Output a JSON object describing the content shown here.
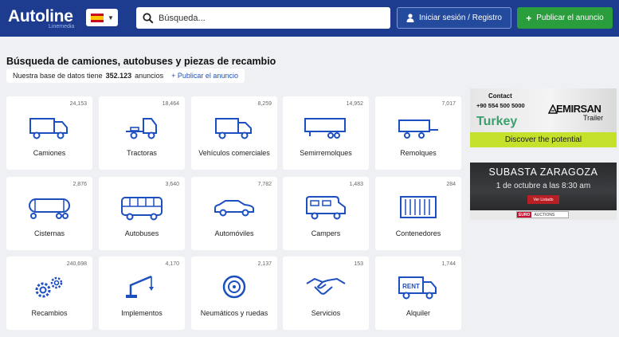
{
  "header": {
    "logo": "Autoline",
    "logo_sub": "Linemedia",
    "search_placeholder": "Búsqueda...",
    "login_label": "Iniciar sesión / Registro",
    "publish_label": "Publicar el anuncio"
  },
  "main": {
    "title": "Búsqueda de camiones, autobuses y piezas de recambio",
    "db_text": "Nuestra base de datos tiene",
    "db_count": "352.123",
    "db_suffix": "anuncios",
    "db_link": "+ Publicar el anuncio"
  },
  "categories": [
    {
      "label": "Camiones",
      "count": "24,153",
      "icon": "truck-icon"
    },
    {
      "label": "Tractoras",
      "count": "18,464",
      "icon": "tractor-unit-icon"
    },
    {
      "label": "Vehículos comerciales",
      "count": "8,259",
      "icon": "van-icon"
    },
    {
      "label": "Semirremolques",
      "count": "14,952",
      "icon": "semitrailer-icon"
    },
    {
      "label": "Remolques",
      "count": "7,017",
      "icon": "trailer-icon"
    },
    {
      "label": "Cisternas",
      "count": "2,876",
      "icon": "tank-icon"
    },
    {
      "label": "Autobuses",
      "count": "3,640",
      "icon": "bus-icon"
    },
    {
      "label": "Automóviles",
      "count": "7,782",
      "icon": "car-icon"
    },
    {
      "label": "Campers",
      "count": "1,483",
      "icon": "camper-icon"
    },
    {
      "label": "Contenedores",
      "count": "284",
      "icon": "container-icon"
    },
    {
      "label": "Recambios",
      "count": "240,698",
      "icon": "gears-icon"
    },
    {
      "label": "Implementos",
      "count": "4,170",
      "icon": "crane-icon"
    },
    {
      "label": "Neumáticos y ruedas",
      "count": "2,137",
      "icon": "wheel-icon"
    },
    {
      "label": "Servicios",
      "count": "153",
      "icon": "handshake-icon"
    },
    {
      "label": "Alquiler",
      "count": "1,744",
      "icon": "rent-truck-icon"
    }
  ],
  "ads": {
    "ad1": {
      "contact": "Contact",
      "phone": "+90 554 500 5000",
      "country": "Turkey",
      "brand": "EMIRSAN",
      "brand_sub": "Trailer",
      "tagline": "Discover the potential"
    },
    "ad2": {
      "title": "SUBASTA ZARAGOZA",
      "date": "1 de octubre a las 8:30 am",
      "button": "Ver Listado",
      "logo_a": "EURO",
      "logo_b": "AUCTIONS"
    }
  },
  "colors": {
    "header_bg": "#1d3c8f",
    "accent_green": "#2a9d3c",
    "link_blue": "#1d4fc1",
    "icon_blue": "#1d4fc1"
  }
}
